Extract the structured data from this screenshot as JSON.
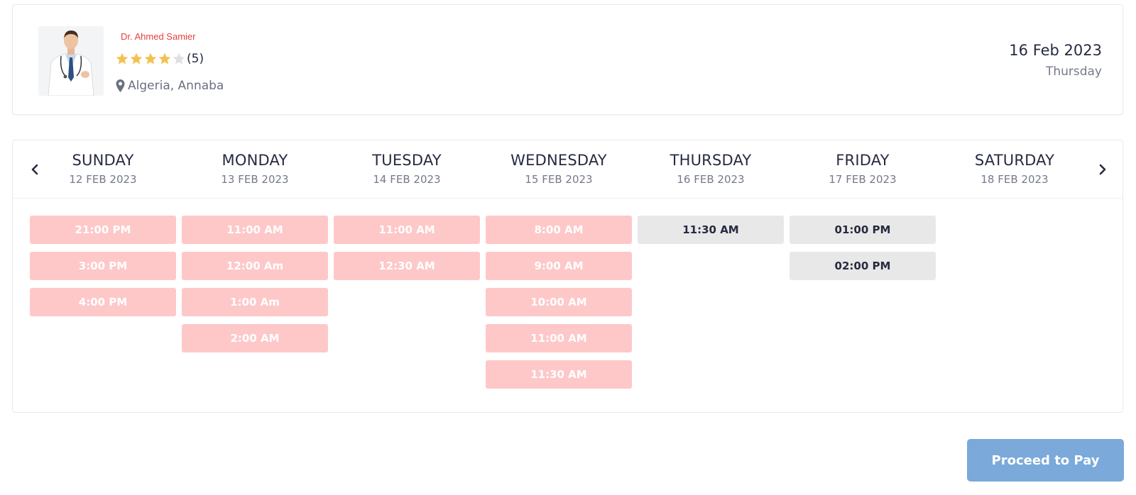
{
  "doctor": {
    "name": "Dr. Ahmed Samier",
    "rating_stars": 4,
    "rating_max": 5,
    "rating_count": "(5)",
    "location": "Algeria, Annaba",
    "star_color": "#f4c150"
  },
  "selected_date": {
    "date": "16 Feb 2023",
    "weekday": "Thursday"
  },
  "schedule": {
    "days": [
      {
        "name": "SUNDAY",
        "date": "12 FEB 2023",
        "slots": [
          {
            "time": "21:00 PM",
            "status": "booked"
          },
          {
            "time": "3:00 PM",
            "status": "booked"
          },
          {
            "time": "4:00 PM",
            "status": "booked"
          }
        ]
      },
      {
        "name": "MONDAY",
        "date": "13 FEB 2023",
        "slots": [
          {
            "time": "11:00 AM",
            "status": "booked"
          },
          {
            "time": "12:00 Am",
            "status": "booked"
          },
          {
            "time": "1:00 Am",
            "status": "booked"
          },
          {
            "time": "2:00 AM",
            "status": "booked"
          }
        ]
      },
      {
        "name": "TUESDAY",
        "date": "14 FEB 2023",
        "slots": [
          {
            "time": "11:00 AM",
            "status": "booked"
          },
          {
            "time": "12:30 AM",
            "status": "booked"
          }
        ]
      },
      {
        "name": "WEDNESDAY",
        "date": "15 FEB 2023",
        "slots": [
          {
            "time": "8:00 AM",
            "status": "booked"
          },
          {
            "time": "9:00 AM",
            "status": "booked"
          },
          {
            "time": "10:00 AM",
            "status": "booked"
          },
          {
            "time": "11:00 AM",
            "status": "booked"
          },
          {
            "time": "11:30 AM",
            "status": "booked"
          }
        ]
      },
      {
        "name": "THURSDAY",
        "date": "16 FEB 2023",
        "slots": [
          {
            "time": "11:30 AM",
            "status": "free"
          }
        ]
      },
      {
        "name": "FRIDAY",
        "date": "17 FEB 2023",
        "slots": [
          {
            "time": "01:00 PM",
            "status": "free"
          },
          {
            "time": "02:00 PM",
            "status": "free"
          }
        ]
      },
      {
        "name": "SATURDAY",
        "date": "18 FEB 2023",
        "slots": []
      }
    ],
    "prev_icon": "chevron-left-icon",
    "next_icon": "chevron-right-icon"
  },
  "actions": {
    "proceed_label": "Proceed to Pay"
  },
  "colors": {
    "booked_slot": "#fec8c8",
    "free_slot": "#e8e8e8",
    "primary_button": "#7aa9da",
    "doctor_name": "#e63f3f"
  }
}
